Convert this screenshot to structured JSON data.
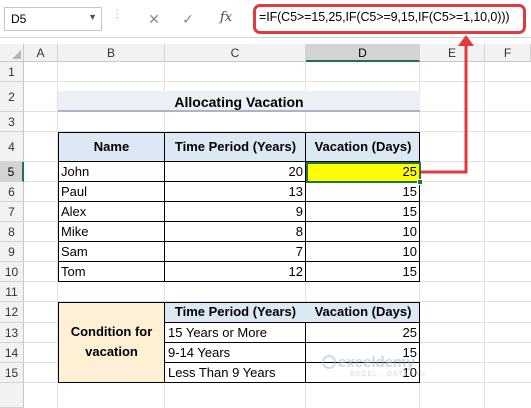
{
  "formula_bar": {
    "name_box": "D5",
    "cancel_symbol": "✕",
    "enter_symbol": "✓",
    "fx_label": "fx",
    "formula": "=IF(C5>=15,25,IF(C5>=9,15,IF(C5>=1,10,0)))"
  },
  "columns": [
    "A",
    "B",
    "C",
    "D",
    "E",
    "F"
  ],
  "rows": [
    "1",
    "2",
    "3",
    "4",
    "5",
    "6",
    "7",
    "8",
    "9",
    "10",
    "11",
    "12",
    "13",
    "14",
    "15"
  ],
  "title": "Allocating Vacation",
  "table1": {
    "headers": [
      "Name",
      "Time Period (Years)",
      "Vacation (Days)"
    ],
    "rows": [
      {
        "name": "John",
        "years": "20",
        "days": "25"
      },
      {
        "name": "Paul",
        "years": "13",
        "days": "15"
      },
      {
        "name": "Alex",
        "years": "9",
        "days": "15"
      },
      {
        "name": "Mike",
        "years": "8",
        "days": "10"
      },
      {
        "name": "Sam",
        "years": "7",
        "days": "10"
      },
      {
        "name": "Tom",
        "years": "12",
        "days": "15"
      }
    ]
  },
  "table2": {
    "condition_label_1": "Condition for",
    "condition_label_2": "vacation",
    "headers": [
      "Time Period (Years)",
      "Vacation (Days)"
    ],
    "rows": [
      {
        "period": "15 Years or More",
        "days": "25"
      },
      {
        "period": "9-14 Years",
        "days": "15"
      },
      {
        "period": "Less Than 9 Years",
        "days": "10"
      }
    ]
  },
  "watermark": {
    "name": "exceldemy",
    "tagline": "EXCEL · DATA · BI"
  },
  "colors": {
    "accent_red": "#e03a3e",
    "selection_green": "#217346",
    "highlight_yellow": "#ffff00"
  }
}
